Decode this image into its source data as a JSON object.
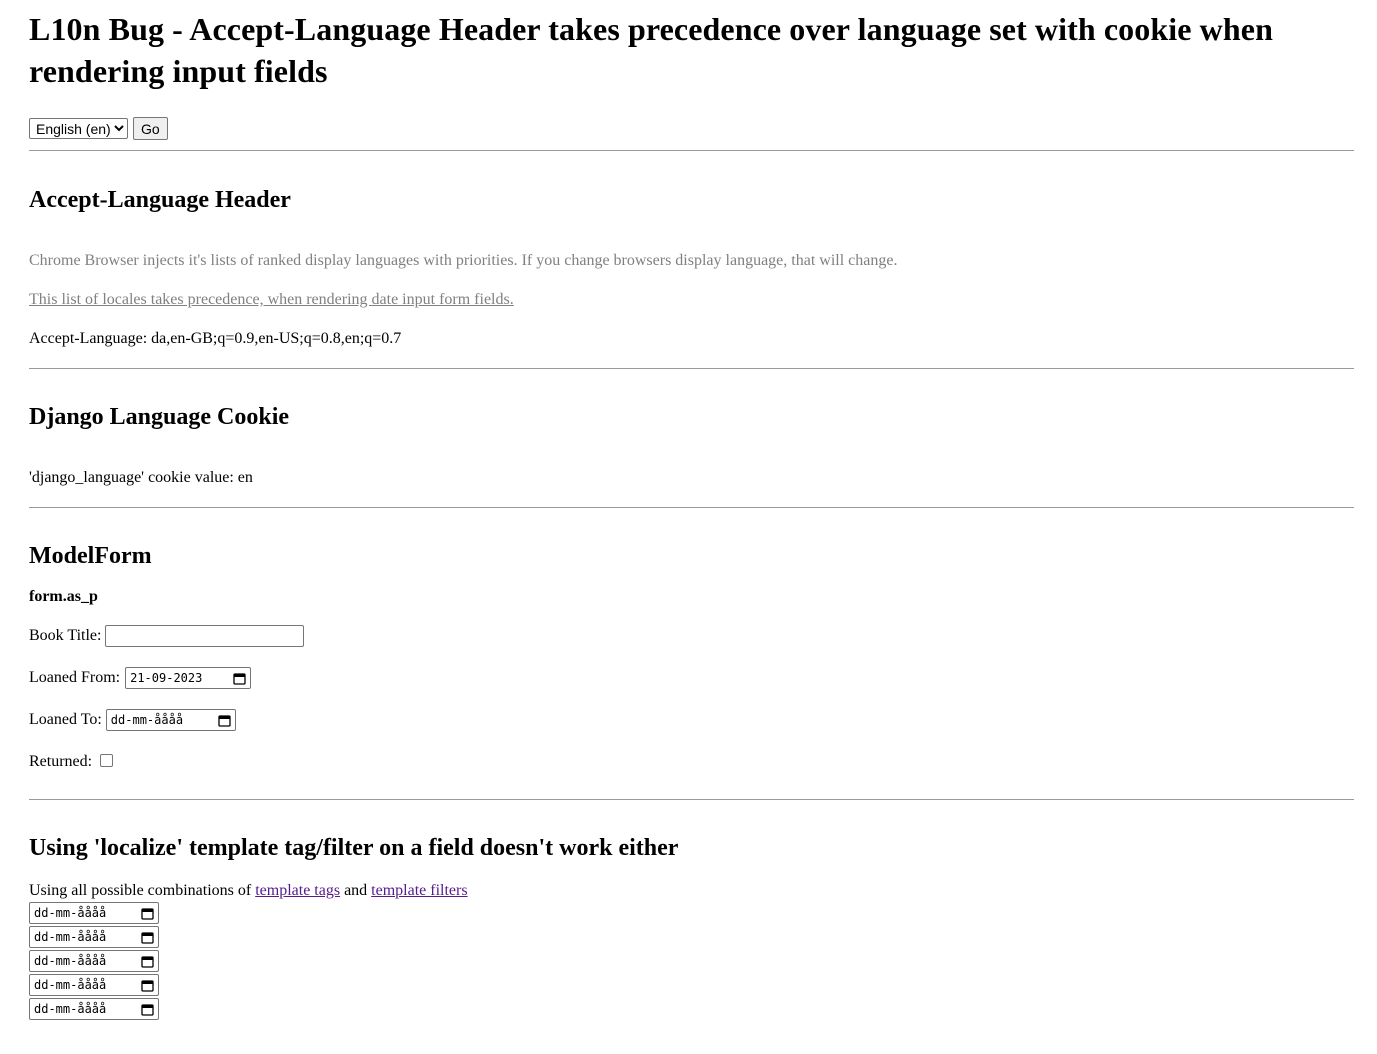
{
  "title": "L10n Bug - Accept-Language Header takes precedence over language set with cookie when rendering input fields",
  "language_form": {
    "selected_option": "English (en)",
    "go_label": "Go"
  },
  "accept_language_section": {
    "heading": "Accept-Language Header",
    "description": "Chrome Browser injects it's lists of ranked display languages with priorities. If you change browsers display language, that will change.",
    "note_link": "This list of locales takes precedence, when rendering date input form fields.",
    "header_line": "Accept-Language: da,en-GB;q=0.9,en-US;q=0.8,en;q=0.7"
  },
  "cookie_section": {
    "heading": "Django Language Cookie",
    "cookie_line": "'django_language' cookie value: en"
  },
  "modelform_section": {
    "heading": "ModelForm",
    "subheading": "form.as_p",
    "book_title_label": "Book Title:",
    "book_title_value": "",
    "loaned_from_label": "Loaned From:",
    "loaned_from_value": "21-09-2023",
    "loaned_to_label": "Loaned To:",
    "loaned_to_value": "dd-mm-åååå",
    "returned_label": "Returned:",
    "returned_checked": false
  },
  "localize_section": {
    "heading": "Using 'localize' template tag/filter on a field doesn't work either",
    "intro_text": "Using all possible combinations of",
    "tags_link": "template tags",
    "and_text": "and",
    "filters_link": "template filters",
    "date_inputs": [
      "dd-mm-åååå",
      "dd-mm-åååå",
      "dd-mm-åååå",
      "dd-mm-åååå",
      "dd-mm-åååå"
    ]
  }
}
